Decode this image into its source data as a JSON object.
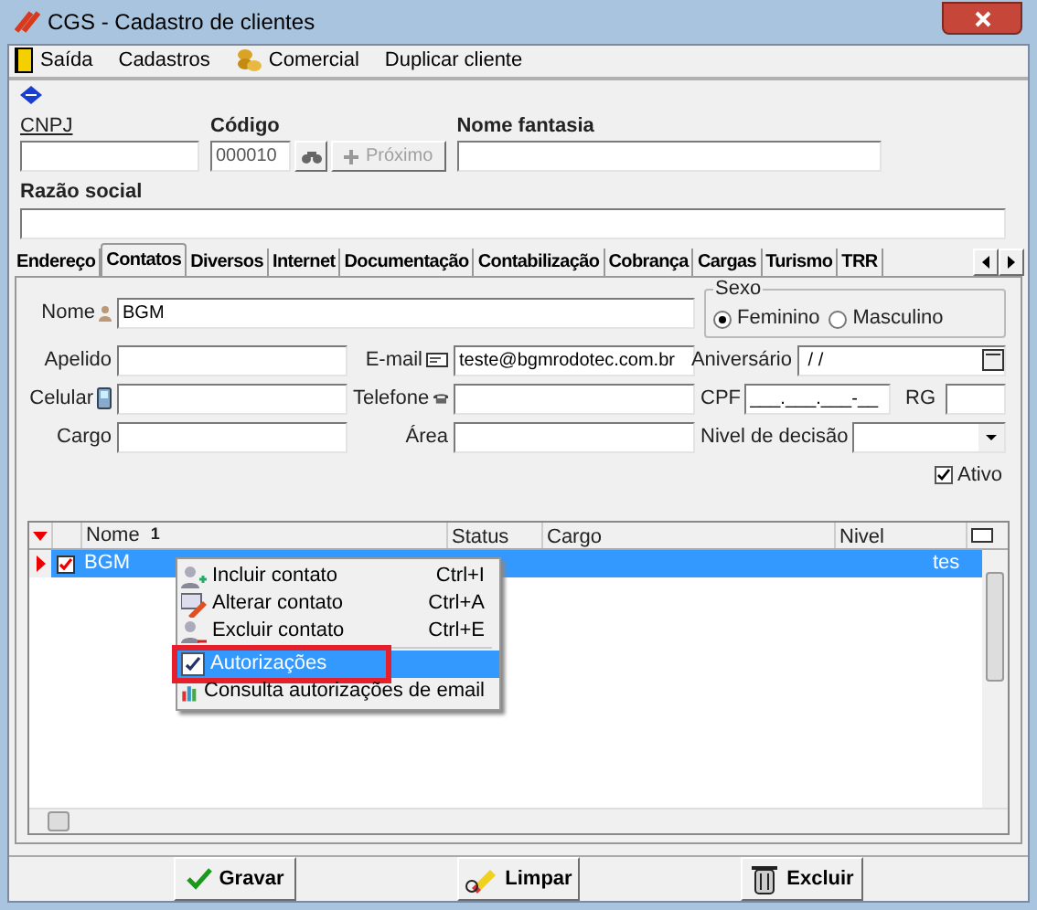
{
  "window": {
    "title": "CGS - Cadastro de clientes"
  },
  "menu": [
    {
      "label": "Saída"
    },
    {
      "label": "Cadastros"
    },
    {
      "label": "Comercial"
    },
    {
      "label": "Duplicar cliente"
    }
  ],
  "header": {
    "cnpj_label": "CNPJ",
    "codigo_label": "Código",
    "codigo_value": "000010",
    "next_button": "Próximo",
    "next_disabled": true,
    "fantasia_label": "Nome fantasia",
    "razao_label": "Razão social"
  },
  "tabs": [
    {
      "label": "Endereço",
      "selected": false
    },
    {
      "label": "Contatos",
      "selected": true
    },
    {
      "label": "Diversos",
      "selected": false
    },
    {
      "label": "Internet",
      "selected": false
    },
    {
      "label": "Documentação",
      "selected": false
    },
    {
      "label": "Contabilização",
      "selected": false
    },
    {
      "label": "Cobrança",
      "selected": false
    },
    {
      "label": "Cargas",
      "selected": false
    },
    {
      "label": "Turismo",
      "selected": false
    },
    {
      "label": "TRR",
      "selected": false
    }
  ],
  "contact": {
    "nome_label": "Nome",
    "nome": "BGM",
    "sexo_label": "Sexo",
    "sexo": [
      {
        "label": "Feminino",
        "selected": true
      },
      {
        "label": "Masculino",
        "selected": false
      }
    ],
    "apelido_label": "Apelido",
    "email_label": "E-mail",
    "email": "teste@bgmrodotec.com.br",
    "aniversario_label": "Aniversário",
    "aniversario": " / /",
    "celular_label": "Celular",
    "telefone_label": "Telefone",
    "cpf_label": "CPF",
    "cpf": "___.___.___-__",
    "rg_label": "RG",
    "cargo_label": "Cargo",
    "area_label": "Área",
    "nivel_label": "Nivel de decisão",
    "ativo_label": "Ativo",
    "ativo": true
  },
  "grid": {
    "columns": [
      "Nome",
      "Status",
      "Cargo",
      "Nivel"
    ],
    "sort_mark": "1",
    "rows": [
      {
        "nome": "BGM",
        "checked": true,
        "selected": true,
        "last": "tes"
      }
    ]
  },
  "context_menu": [
    {
      "label": "Incluir contato",
      "shortcut": "Ctrl+I",
      "selected": false
    },
    {
      "label": "Alterar contato",
      "shortcut": "Ctrl+A",
      "selected": false
    },
    {
      "label": "Excluir contato",
      "shortcut": "Ctrl+E",
      "selected": false
    },
    {
      "label": "Autorizações",
      "selected": true,
      "separator_before": true,
      "highlighted": true
    },
    {
      "label": "Consulta autorizações de email",
      "selected": false
    }
  ],
  "buttons": [
    {
      "label": "Gravar"
    },
    {
      "label": "Limpar"
    },
    {
      "label": "Excluir"
    }
  ]
}
